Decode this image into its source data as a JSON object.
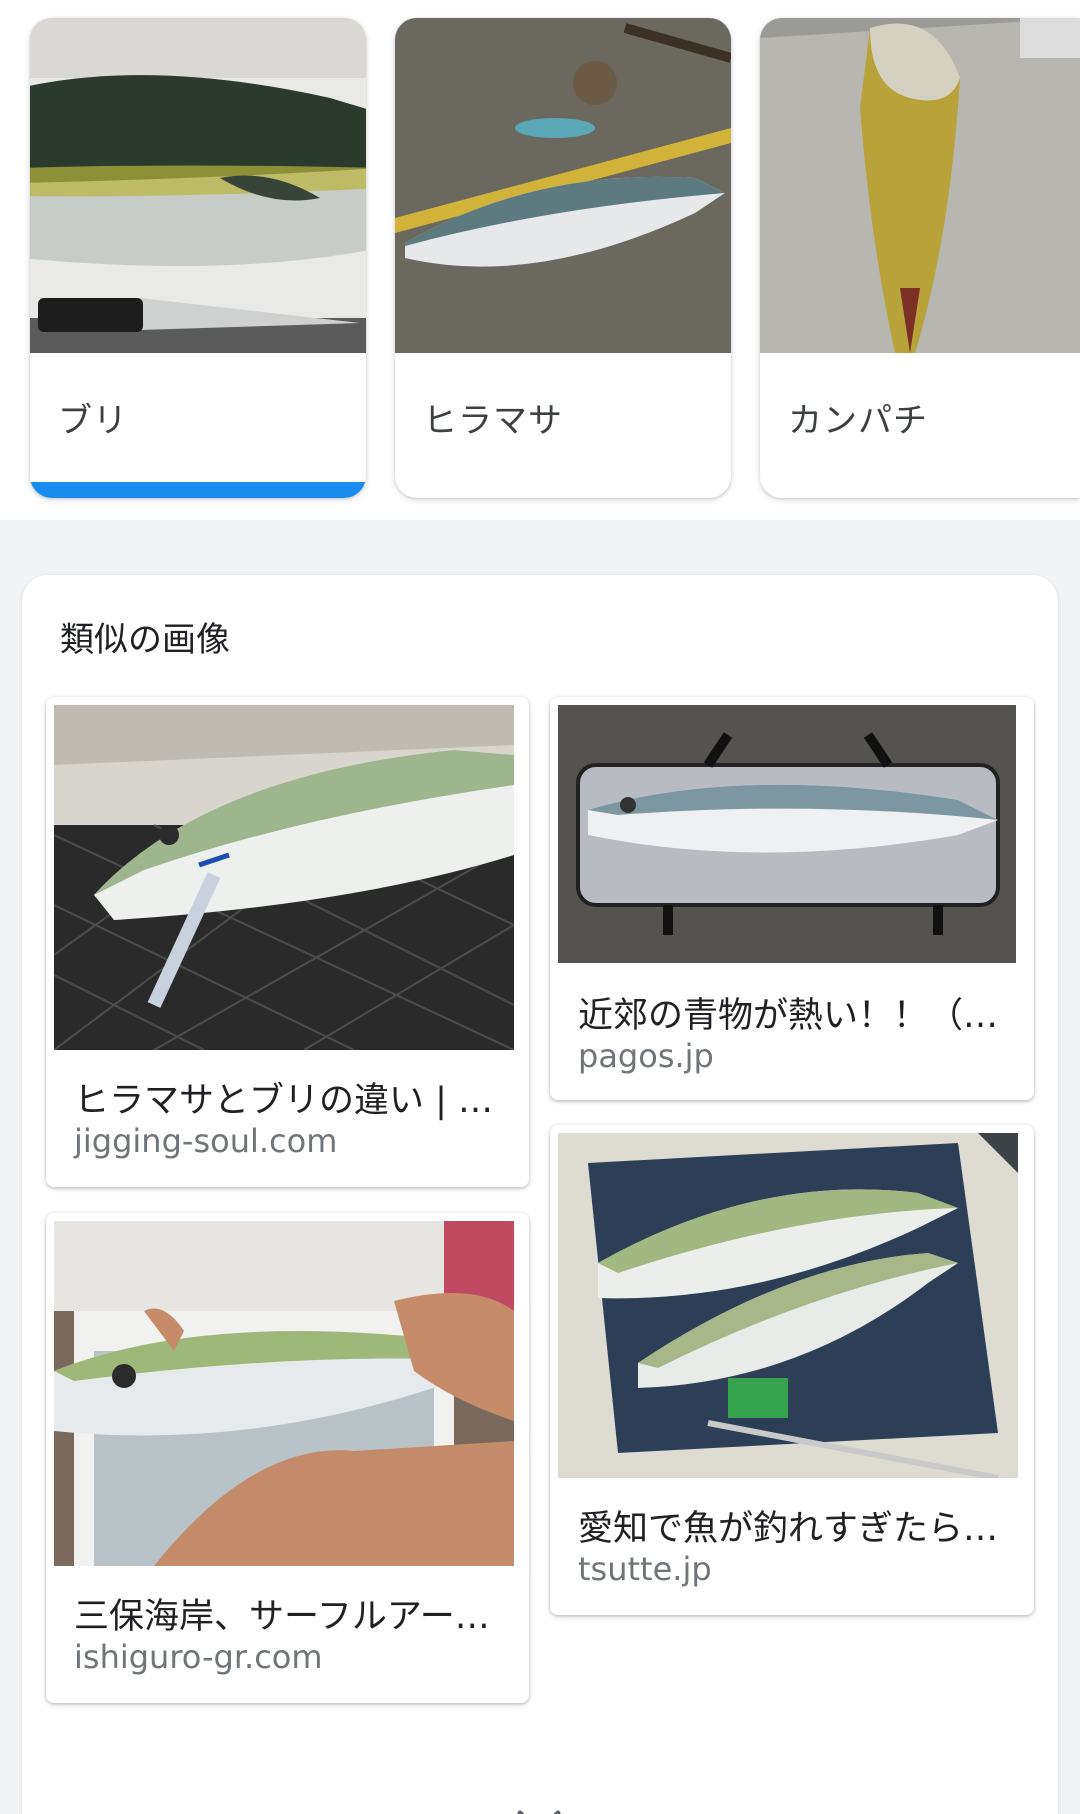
{
  "suggestions": [
    {
      "label": "ブリ",
      "selected": true
    },
    {
      "label": "ヒラマサ",
      "selected": false
    },
    {
      "label": "カンパチ",
      "selected": false
    }
  ],
  "similar": {
    "title": "類似の画像",
    "results": [
      {
        "title": "ヒラマサとブリの違い | 1…",
        "source": "jigging-soul.com"
      },
      {
        "title": "近郊の青物が熱い！！（…",
        "source": "pagos.jp"
      },
      {
        "title": "三保海岸、サーフルアー…",
        "source": "ishiguro-gr.com"
      },
      {
        "title": "愛知で魚が釣れすぎたら…",
        "source": "tsutte.jp"
      }
    ]
  },
  "colors": {
    "selected_bar": "#1a8cf0",
    "source_text": "#70757a"
  },
  "icons": {
    "expand": "chevron-down-icon"
  }
}
